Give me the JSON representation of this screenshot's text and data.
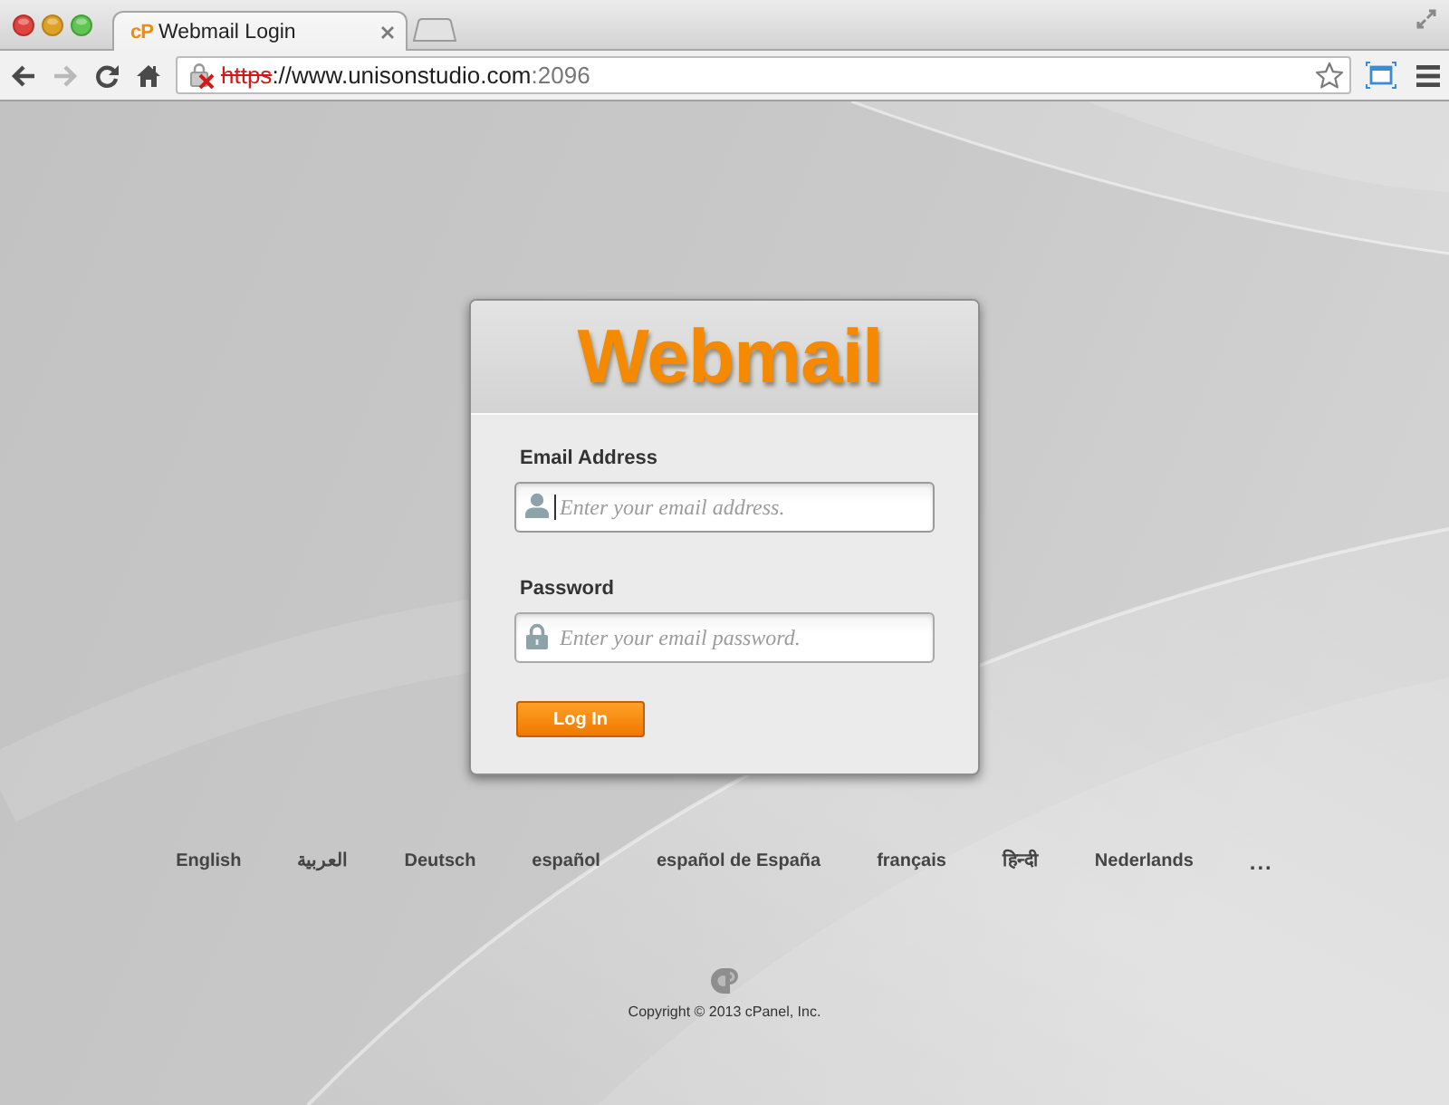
{
  "browser": {
    "tabs": [
      {
        "favicon": "cP",
        "title": "Webmail Login",
        "selected": true
      }
    ],
    "toolbar": {
      "back": {
        "disabled": false
      },
      "forward": {
        "disabled": true
      }
    },
    "address": {
      "certificate_error": true,
      "scheme": "https",
      "rest": "://www.unisonstudio.com",
      "port": ":2096"
    }
  },
  "login": {
    "heading": "Webmail",
    "fields": [
      {
        "kind": "email",
        "label": "Email Address",
        "placeholder": "Enter your email address.",
        "focused": true
      },
      {
        "kind": "password",
        "label": "Password",
        "placeholder": "Enter your email password.",
        "focused": false
      }
    ],
    "submit": "Log In"
  },
  "languages": {
    "items": [
      "English",
      "العربية",
      "Deutsch",
      "español",
      "español de España",
      "français",
      "हिन्दी",
      "Nederlands"
    ],
    "more": "..."
  },
  "footer": {
    "copyright": "Copyright © 2013 cPanel, Inc."
  }
}
